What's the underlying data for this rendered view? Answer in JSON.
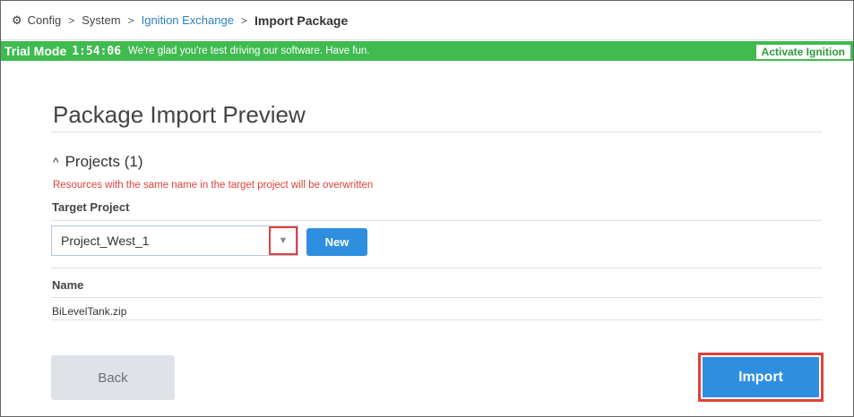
{
  "breadcrumb": {
    "icon": "gear-icon",
    "items": [
      "Config",
      "System",
      "Ignition Exchange",
      "Import Package"
    ],
    "separator": ">"
  },
  "trial": {
    "mode": "Trial Mode",
    "timer": "1:54:06",
    "message": "We're glad you're test driving our software. Have fun.",
    "activate": "Activate Ignition",
    "color": "#3fbb4f"
  },
  "page": {
    "title": "Package Import Preview"
  },
  "projects": {
    "heading": "Projects (1)",
    "warning": "Resources with the same name in the target project will be overwritten",
    "target_label": "Target Project",
    "selected": "Project_West_1",
    "new_label": "New",
    "name_label": "Name",
    "files": [
      "BiLevelTank.zip"
    ]
  },
  "actions": {
    "back": "Back",
    "import": "Import"
  },
  "colors": {
    "accent": "#2e8fe0",
    "warning": "#e0413a",
    "highlight": "#e0413a"
  }
}
